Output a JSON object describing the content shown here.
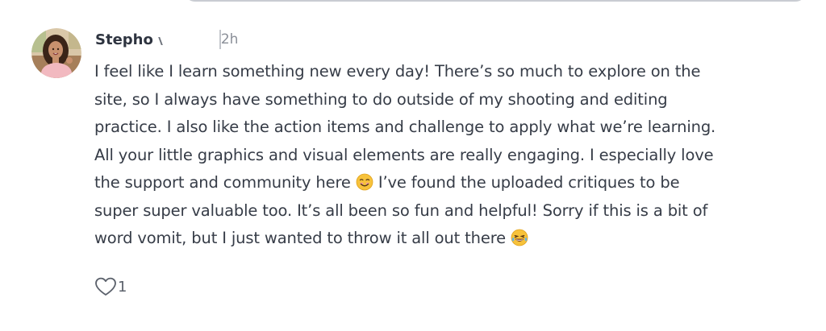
{
  "comment": {
    "author": "Stepho",
    "timestamp": "2h",
    "lines": [
      "I feel like I learn something new every day! There’s so much to explore on the",
      "site, so I always have something to do outside of my shooting and editing",
      "practice. I also like the action items and challenge to apply what we’re learning.",
      "All your little graphics and visual elements are really engaging. I especially love",
      "the support and community here",
      " I’ve found the uploaded critiques to be",
      "super super valuable too. It’s all been so fun and helpful! Sorry if this is a bit of",
      "word vomit, but I just wanted to throw it all out there"
    ],
    "emojis": [
      "smiling-face-emoji",
      "tears-of-joy-emoji"
    ],
    "like_count": "1"
  },
  "icons": {
    "like": "heart-outline-icon"
  },
  "colors": {
    "text": "#363c47",
    "author": "#2e3440",
    "muted": "#8a8f98",
    "emoji_yellow": "#f7c23b",
    "input_border": "#c9ccd2"
  }
}
